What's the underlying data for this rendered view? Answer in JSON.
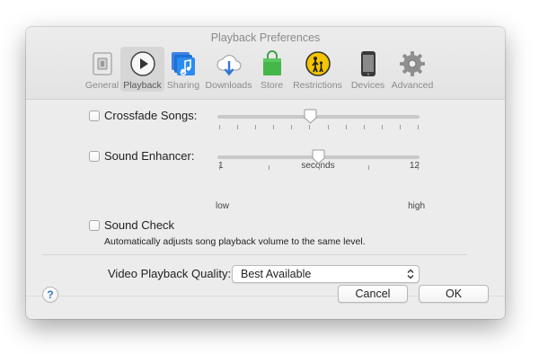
{
  "window": {
    "title": "Playback Preferences"
  },
  "toolbar": {
    "items": [
      {
        "label": "General",
        "icon": "general-icon"
      },
      {
        "label": "Playback",
        "icon": "play-icon",
        "selected": true
      },
      {
        "label": "Sharing",
        "icon": "music-note-icon"
      },
      {
        "label": "Downloads",
        "icon": "cloud-download-icon"
      },
      {
        "label": "Store",
        "icon": "shopping-bag-icon"
      },
      {
        "label": "Restrictions",
        "icon": "parental-icon"
      },
      {
        "label": "Devices",
        "icon": "iphone-icon"
      },
      {
        "label": "Advanced",
        "icon": "gear-icon"
      }
    ]
  },
  "crossfade": {
    "label": "Crossfade Songs:",
    "checked": false,
    "min_label": "1",
    "unit_label": "seconds",
    "max_label": "12",
    "value_fraction": 0.46
  },
  "enhancer": {
    "label": "Sound Enhancer:",
    "checked": false,
    "min_label": "low",
    "max_label": "high",
    "value_fraction": 0.5
  },
  "soundcheck": {
    "label": "Sound Check",
    "checked": false,
    "note": "Automatically adjusts song playback volume to the same level."
  },
  "video": {
    "label": "Video Playback Quality:",
    "value": "Best Available"
  },
  "buttons": {
    "help": "?",
    "cancel": "Cancel",
    "ok": "OK"
  },
  "colors": {
    "window_bg": "#ececec",
    "accent_blue": "#2f76d6",
    "store_green": "#45b649",
    "restrictions_yellow": "#f5c400"
  }
}
